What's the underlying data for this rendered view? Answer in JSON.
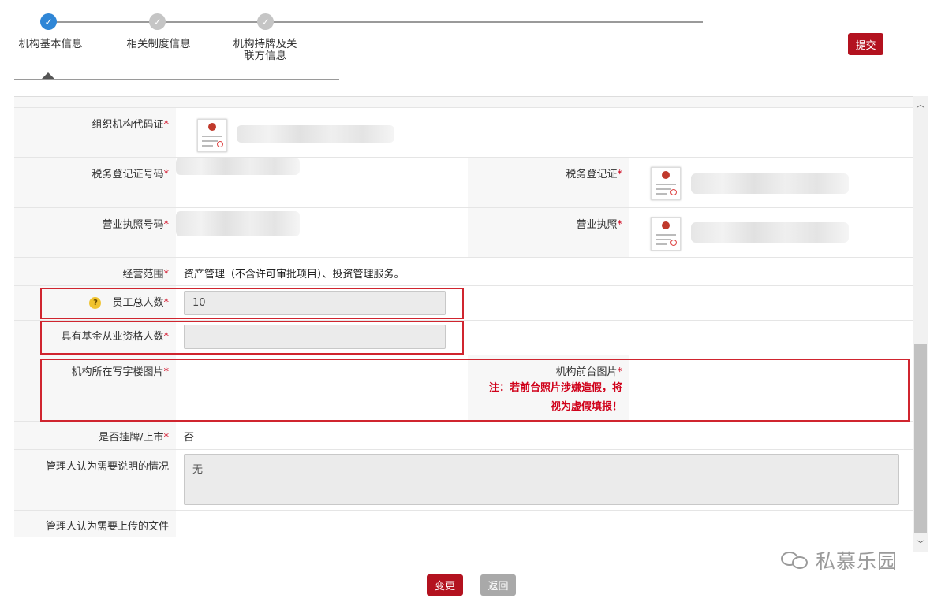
{
  "stepper": {
    "steps": [
      {
        "label": "机构基本信息",
        "state": "done"
      },
      {
        "label": "相关制度信息",
        "state": "pending"
      },
      {
        "label": "机构持牌及关联方信息",
        "label_line1": "机构持牌及关",
        "label_line2": "联方信息",
        "state": "pending"
      }
    ]
  },
  "toolbar": {
    "submit_label": "提交"
  },
  "form": {
    "org_code_cert": {
      "label": "组织机构代码证"
    },
    "tax_reg_number": {
      "label": "税务登记证号码"
    },
    "tax_reg_cert": {
      "label": "税务登记证"
    },
    "biz_license_number": {
      "label": "营业执照号码"
    },
    "biz_license": {
      "label": "营业执照"
    },
    "biz_scope": {
      "label": "经营范围",
      "value": "资产管理（不含许可审批项目）、投资管理服务。"
    },
    "employee_total": {
      "label": "员工总人数",
      "value": "10"
    },
    "fund_qualified": {
      "label": "具有基金从业资格人数",
      "value": ""
    },
    "office_photo": {
      "label": "机构所在写字楼图片"
    },
    "front_desk_photo": {
      "label": "机构前台图片",
      "note_line1": "注：若前台照片涉嫌造假，将",
      "note_line2": "视为虚假填报！"
    },
    "listed": {
      "label": "是否挂牌/上市",
      "value": "否"
    },
    "manager_notes": {
      "label": "管理人认为需要说明的情况",
      "value": "无"
    },
    "manager_files": {
      "label": "管理人认为需要上传的文件"
    }
  },
  "footer": {
    "change_label": "变更",
    "back_label": "返回"
  },
  "watermark": {
    "text": "私慕乐园"
  },
  "colors": {
    "accent_red": "#b3121f",
    "step_active": "#2f86d6",
    "highlight_border": "#d0252f",
    "required": "#d0021b"
  }
}
